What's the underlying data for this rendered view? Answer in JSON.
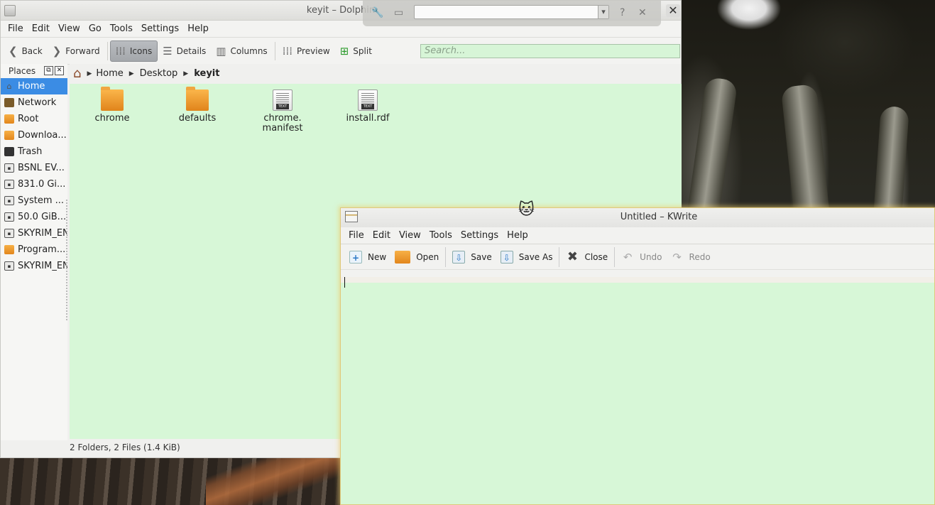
{
  "dolphin": {
    "title": "keyit – Dolphin",
    "menu": [
      "File",
      "Edit",
      "View",
      "Go",
      "Tools",
      "Settings",
      "Help"
    ],
    "toolbar": {
      "back": "Back",
      "forward": "Forward",
      "icons": "Icons",
      "details": "Details",
      "columns": "Columns",
      "preview": "Preview",
      "split": "Split"
    },
    "search_placeholder": "Search...",
    "places": {
      "header": "Places",
      "items": [
        {
          "label": "Home",
          "icon": "home-icon"
        },
        {
          "label": "Network",
          "icon": "network-icon"
        },
        {
          "label": "Root",
          "icon": "folder-icon"
        },
        {
          "label": "Downloa...",
          "icon": "folder-icon"
        },
        {
          "label": "Trash",
          "icon": "trash-icon"
        },
        {
          "label": "BSNL EV...",
          "icon": "drive-icon"
        },
        {
          "label": "831.0 Gi...",
          "icon": "drive-icon"
        },
        {
          "label": "System ...",
          "icon": "drive-icon"
        },
        {
          "label": "50.0 GiB...",
          "icon": "drive-icon"
        },
        {
          "label": "SKYRIM_EN",
          "icon": "drive-icon"
        },
        {
          "label": "Program...",
          "icon": "folder-icon"
        },
        {
          "label": "SKYRIM_EN",
          "icon": "drive-icon"
        }
      ]
    },
    "breadcrumb": [
      "Home",
      "Desktop",
      "keyit"
    ],
    "files": [
      {
        "name": "chrome",
        "type": "folder"
      },
      {
        "name": "defaults",
        "type": "folder"
      },
      {
        "name": "chrome.\nmanifest",
        "type": "text"
      },
      {
        "name": "install.rdf",
        "type": "text"
      }
    ],
    "status": "2 Folders, 2 Files (1.4 KiB)"
  },
  "kwrite": {
    "title": "Untitled – KWrite",
    "menu": [
      "File",
      "Edit",
      "View",
      "Tools",
      "Settings",
      "Help"
    ],
    "toolbar": {
      "new": "New",
      "open": "Open",
      "save": "Save",
      "save_as": "Save As",
      "close": "Close",
      "undo": "Undo",
      "redo": "Redo"
    }
  },
  "colors": {
    "view_background": "#d7f7d7",
    "selection": "#3b8ce4",
    "active_border": "#e0c87a"
  }
}
